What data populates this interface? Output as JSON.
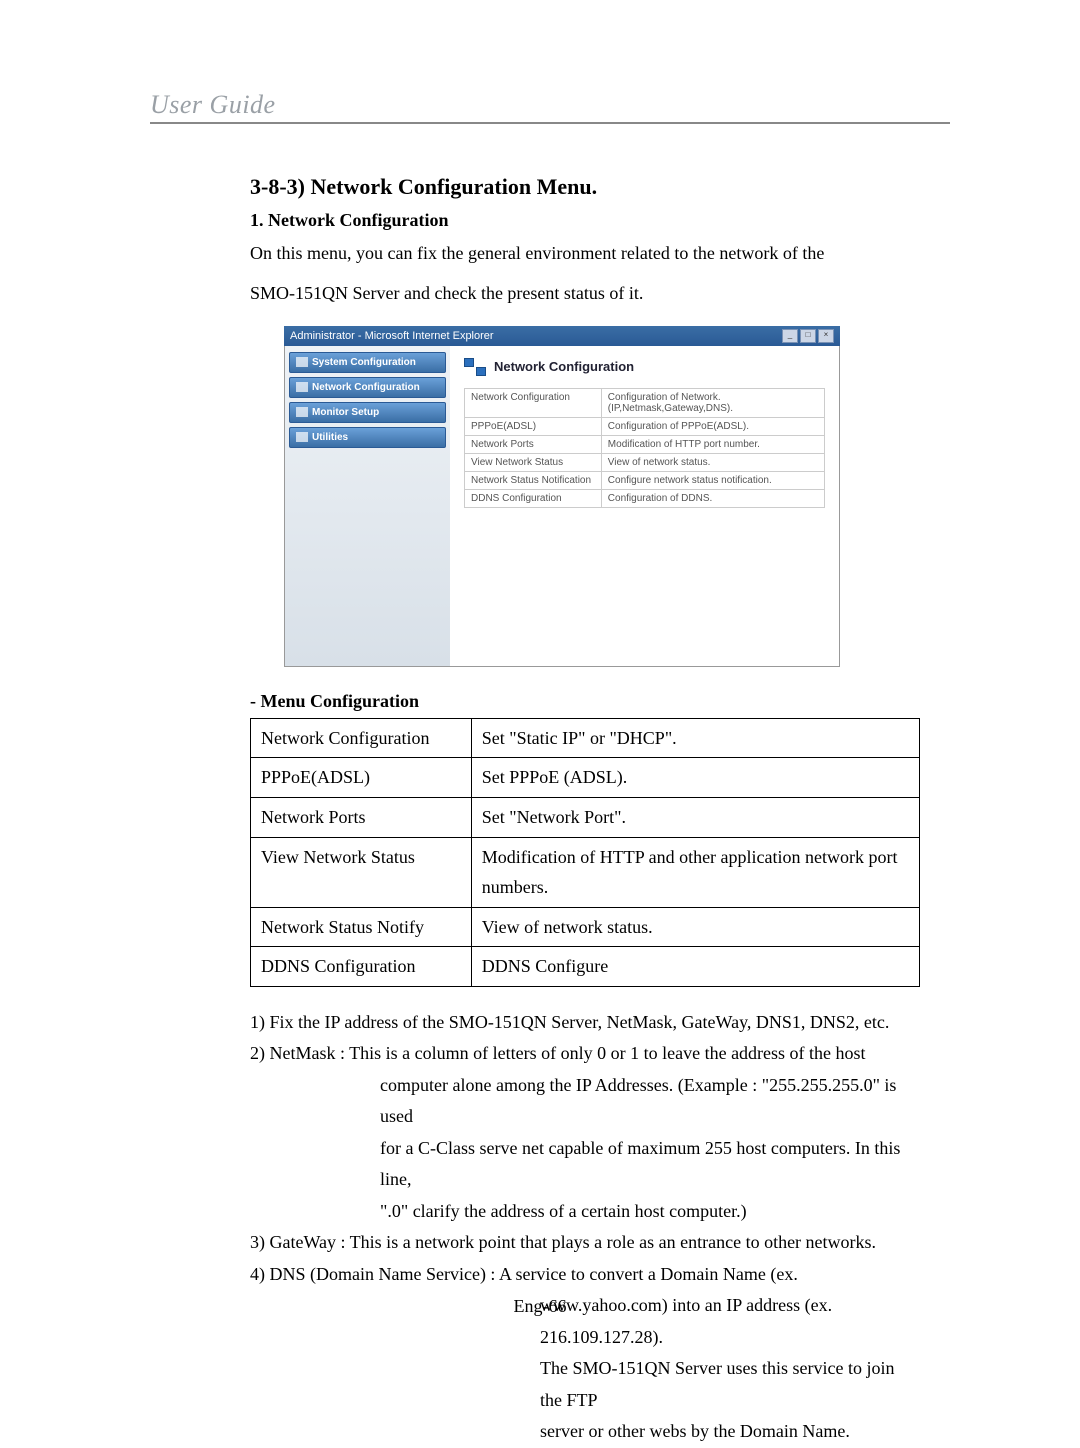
{
  "header": {
    "guide_title": "User Guide"
  },
  "section": {
    "heading": "3-8-3) Network Configuration Menu.",
    "sub1_heading": "1. Network Configuration",
    "intro_line1": "On this menu, you can fix the general environment related to the network of the",
    "intro_line2": "SMO-151QN Server and check the present status of it."
  },
  "screenshot": {
    "window_title": "Administrator - Microsoft Internet Explorer",
    "sidebar": {
      "items": [
        {
          "label": "System Configuration"
        },
        {
          "label": "Network Configuration"
        },
        {
          "label": "Monitor Setup"
        },
        {
          "label": "Utilities"
        }
      ]
    },
    "main": {
      "title": "Network Configuration",
      "rows": [
        {
          "name": "Network Configuration",
          "desc": "Configuration of Network. (IP,Netmask,Gateway,DNS)."
        },
        {
          "name": "PPPoE(ADSL)",
          "desc": "Configuration of PPPoE(ADSL)."
        },
        {
          "name": "Network Ports",
          "desc": "Modification of HTTP port number."
        },
        {
          "name": "View Network Status",
          "desc": "View of network status."
        },
        {
          "name": "Network Status Notification",
          "desc": "Configure network status notification."
        },
        {
          "name": "DDNS Configuration",
          "desc": "Configuration of DDNS."
        }
      ]
    }
  },
  "menu_config": {
    "heading": "- Menu Configuration",
    "rows": [
      {
        "name": "Network Configuration",
        "desc": "Set \"Static IP\" or \"DHCP\"."
      },
      {
        "name": "PPPoE(ADSL)",
        "desc": "Set PPPoE (ADSL)."
      },
      {
        "name": "Network Ports",
        "desc": "Set \"Network Port\"."
      },
      {
        "name": "View Network Status",
        "desc": "Modification of HTTP and other application network port numbers."
      },
      {
        "name": "Network Status Notify",
        "desc": "View of network status."
      },
      {
        "name": "DDNS Configuration",
        "desc": "DDNS Configure"
      }
    ]
  },
  "notes": {
    "n1": "1) Fix the IP address of the SMO-151QN Server, NetMask, GateWay, DNS1, DNS2, etc.",
    "n2a": "2) NetMask : This is a column of letters of only 0 or 1 to  leave the address of the host",
    "n2b": "computer alone among the IP Addresses. (Example : \"255.255.255.0\" is used",
    "n2c": "for a C-Class serve net capable of maximum 255 host computers. In this line,",
    "n2d": "\".0\" clarify the address of a certain host computer.)",
    "n3": "3) GateWay : This is a network point that plays a role as an entrance to other networks.",
    "n4a": "4) DNS (Domain Name Service) : A service to convert a Domain Name (ex.",
    "n4b": "www.yahoo.com) into an IP address (ex. 216.109.127.28).",
    "n4c": "The SMO-151QN Server uses this service to join the FTP",
    "n4d": "server or other webs by the Domain Name."
  },
  "page_number": "Eng-66"
}
